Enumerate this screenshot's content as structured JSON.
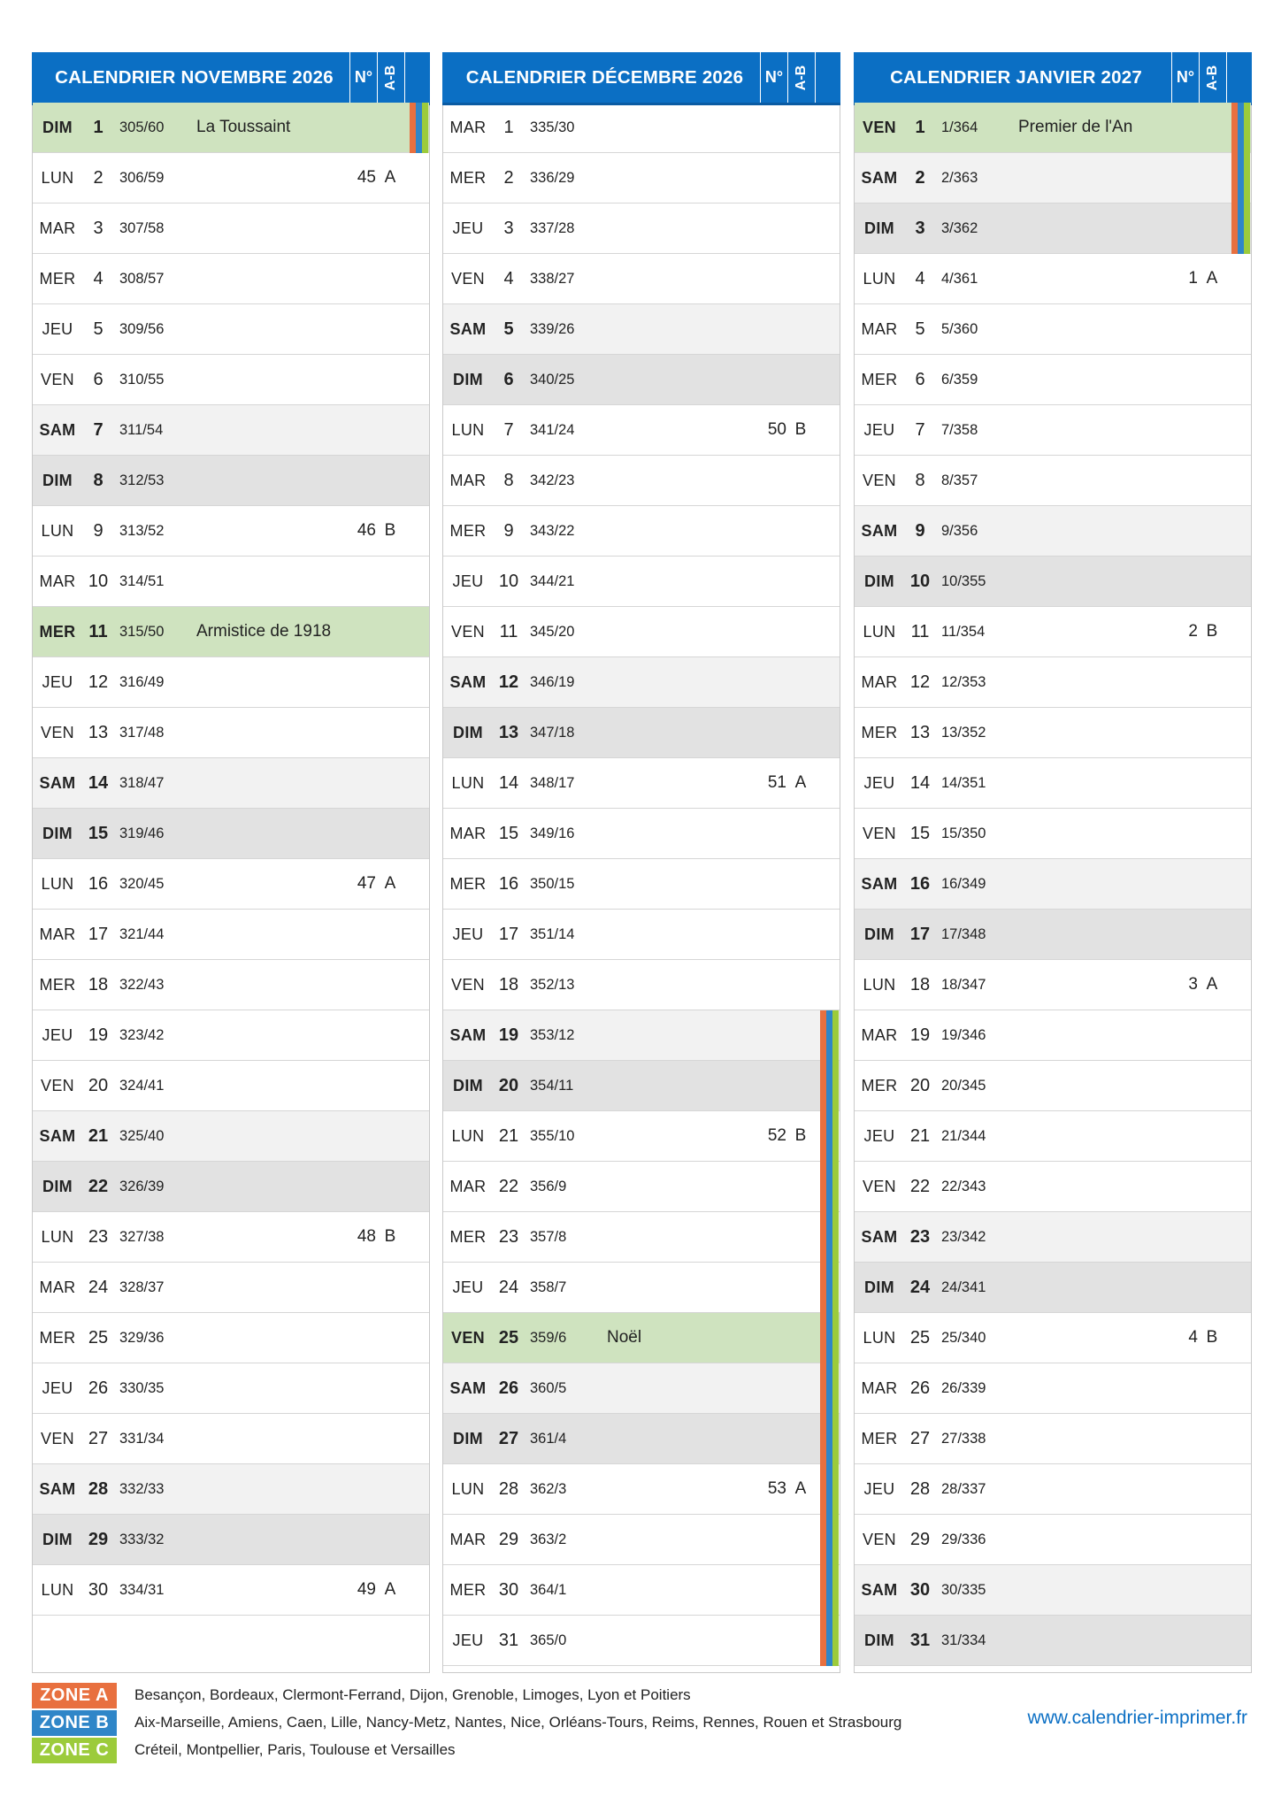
{
  "colors": {
    "header": "#0b6fc4",
    "zone_a": "#e8703f",
    "zone_b": "#2f86c8",
    "zone_c": "#9ccb3b",
    "holiday": "#cfe3bf"
  },
  "header_labels": {
    "num": "N°",
    "ab": "A-B"
  },
  "months": [
    {
      "title": "CALENDRIER NOVEMBRE 2026",
      "days": [
        {
          "dow": "DIM",
          "d": "1",
          "doy": "305/60",
          "type": "hol",
          "hol": "La Toussaint",
          "zones": [
            "a",
            "b",
            "c"
          ]
        },
        {
          "dow": "LUN",
          "d": "2",
          "doy": "306/59",
          "wk": "45",
          "ab": "A"
        },
        {
          "dow": "MAR",
          "d": "3",
          "doy": "307/58"
        },
        {
          "dow": "MER",
          "d": "4",
          "doy": "308/57"
        },
        {
          "dow": "JEU",
          "d": "5",
          "doy": "309/56"
        },
        {
          "dow": "VEN",
          "d": "6",
          "doy": "310/55"
        },
        {
          "dow": "SAM",
          "d": "7",
          "doy": "311/54",
          "type": "sat"
        },
        {
          "dow": "DIM",
          "d": "8",
          "doy": "312/53",
          "type": "sun"
        },
        {
          "dow": "LUN",
          "d": "9",
          "doy": "313/52",
          "wk": "46",
          "ab": "B"
        },
        {
          "dow": "MAR",
          "d": "10",
          "doy": "314/51"
        },
        {
          "dow": "MER",
          "d": "11",
          "doy": "315/50",
          "type": "hol",
          "hol": "Armistice de 1918"
        },
        {
          "dow": "JEU",
          "d": "12",
          "doy": "316/49"
        },
        {
          "dow": "VEN",
          "d": "13",
          "doy": "317/48"
        },
        {
          "dow": "SAM",
          "d": "14",
          "doy": "318/47",
          "type": "sat"
        },
        {
          "dow": "DIM",
          "d": "15",
          "doy": "319/46",
          "type": "sun"
        },
        {
          "dow": "LUN",
          "d": "16",
          "doy": "320/45",
          "wk": "47",
          "ab": "A"
        },
        {
          "dow": "MAR",
          "d": "17",
          "doy": "321/44"
        },
        {
          "dow": "MER",
          "d": "18",
          "doy": "322/43"
        },
        {
          "dow": "JEU",
          "d": "19",
          "doy": "323/42"
        },
        {
          "dow": "VEN",
          "d": "20",
          "doy": "324/41"
        },
        {
          "dow": "SAM",
          "d": "21",
          "doy": "325/40",
          "type": "sat"
        },
        {
          "dow": "DIM",
          "d": "22",
          "doy": "326/39",
          "type": "sun"
        },
        {
          "dow": "LUN",
          "d": "23",
          "doy": "327/38",
          "wk": "48",
          "ab": "B"
        },
        {
          "dow": "MAR",
          "d": "24",
          "doy": "328/37"
        },
        {
          "dow": "MER",
          "d": "25",
          "doy": "329/36"
        },
        {
          "dow": "JEU",
          "d": "26",
          "doy": "330/35"
        },
        {
          "dow": "VEN",
          "d": "27",
          "doy": "331/34"
        },
        {
          "dow": "SAM",
          "d": "28",
          "doy": "332/33",
          "type": "sat"
        },
        {
          "dow": "DIM",
          "d": "29",
          "doy": "333/32",
          "type": "sun"
        },
        {
          "dow": "LUN",
          "d": "30",
          "doy": "334/31",
          "wk": "49",
          "ab": "A"
        }
      ]
    },
    {
      "title": "CALENDRIER DÉCEMBRE 2026",
      "days": [
        {
          "dow": "MAR",
          "d": "1",
          "doy": "335/30"
        },
        {
          "dow": "MER",
          "d": "2",
          "doy": "336/29"
        },
        {
          "dow": "JEU",
          "d": "3",
          "doy": "337/28"
        },
        {
          "dow": "VEN",
          "d": "4",
          "doy": "338/27"
        },
        {
          "dow": "SAM",
          "d": "5",
          "doy": "339/26",
          "type": "sat"
        },
        {
          "dow": "DIM",
          "d": "6",
          "doy": "340/25",
          "type": "sun"
        },
        {
          "dow": "LUN",
          "d": "7",
          "doy": "341/24",
          "wk": "50",
          "ab": "B"
        },
        {
          "dow": "MAR",
          "d": "8",
          "doy": "342/23"
        },
        {
          "dow": "MER",
          "d": "9",
          "doy": "343/22"
        },
        {
          "dow": "JEU",
          "d": "10",
          "doy": "344/21"
        },
        {
          "dow": "VEN",
          "d": "11",
          "doy": "345/20"
        },
        {
          "dow": "SAM",
          "d": "12",
          "doy": "346/19",
          "type": "sat"
        },
        {
          "dow": "DIM",
          "d": "13",
          "doy": "347/18",
          "type": "sun"
        },
        {
          "dow": "LUN",
          "d": "14",
          "doy": "348/17",
          "wk": "51",
          "ab": "A"
        },
        {
          "dow": "MAR",
          "d": "15",
          "doy": "349/16"
        },
        {
          "dow": "MER",
          "d": "16",
          "doy": "350/15"
        },
        {
          "dow": "JEU",
          "d": "17",
          "doy": "351/14"
        },
        {
          "dow": "VEN",
          "d": "18",
          "doy": "352/13"
        },
        {
          "dow": "SAM",
          "d": "19",
          "doy": "353/12",
          "type": "sat",
          "zones": [
            "a",
            "b",
            "c"
          ]
        },
        {
          "dow": "DIM",
          "d": "20",
          "doy": "354/11",
          "type": "sun",
          "zones": [
            "a",
            "b",
            "c"
          ]
        },
        {
          "dow": "LUN",
          "d": "21",
          "doy": "355/10",
          "wk": "52",
          "ab": "B",
          "zones": [
            "a",
            "b",
            "c"
          ]
        },
        {
          "dow": "MAR",
          "d": "22",
          "doy": "356/9",
          "zones": [
            "a",
            "b",
            "c"
          ]
        },
        {
          "dow": "MER",
          "d": "23",
          "doy": "357/8",
          "zones": [
            "a",
            "b",
            "c"
          ]
        },
        {
          "dow": "JEU",
          "d": "24",
          "doy": "358/7",
          "zones": [
            "a",
            "b",
            "c"
          ]
        },
        {
          "dow": "VEN",
          "d": "25",
          "doy": "359/6",
          "type": "hol",
          "hol": "Noël",
          "zones": [
            "a",
            "b",
            "c"
          ]
        },
        {
          "dow": "SAM",
          "d": "26",
          "doy": "360/5",
          "type": "sat",
          "zones": [
            "a",
            "b",
            "c"
          ]
        },
        {
          "dow": "DIM",
          "d": "27",
          "doy": "361/4",
          "type": "sun",
          "zones": [
            "a",
            "b",
            "c"
          ]
        },
        {
          "dow": "LUN",
          "d": "28",
          "doy": "362/3",
          "wk": "53",
          "ab": "A",
          "zones": [
            "a",
            "b",
            "c"
          ]
        },
        {
          "dow": "MAR",
          "d": "29",
          "doy": "363/2",
          "zones": [
            "a",
            "b",
            "c"
          ]
        },
        {
          "dow": "MER",
          "d": "30",
          "doy": "364/1",
          "zones": [
            "a",
            "b",
            "c"
          ]
        },
        {
          "dow": "JEU",
          "d": "31",
          "doy": "365/0",
          "zones": [
            "a",
            "b",
            "c"
          ]
        }
      ]
    },
    {
      "title": "CALENDRIER JANVIER 2027",
      "days": [
        {
          "dow": "VEN",
          "d": "1",
          "doy": "1/364",
          "type": "hol",
          "hol": "Premier de l'An",
          "zones": [
            "a",
            "b",
            "c"
          ]
        },
        {
          "dow": "SAM",
          "d": "2",
          "doy": "2/363",
          "type": "sat",
          "zones": [
            "a",
            "b",
            "c"
          ]
        },
        {
          "dow": "DIM",
          "d": "3",
          "doy": "3/362",
          "type": "sun",
          "zones": [
            "a",
            "b",
            "c"
          ]
        },
        {
          "dow": "LUN",
          "d": "4",
          "doy": "4/361",
          "wk": "1",
          "ab": "A"
        },
        {
          "dow": "MAR",
          "d": "5",
          "doy": "5/360"
        },
        {
          "dow": "MER",
          "d": "6",
          "doy": "6/359"
        },
        {
          "dow": "JEU",
          "d": "7",
          "doy": "7/358"
        },
        {
          "dow": "VEN",
          "d": "8",
          "doy": "8/357"
        },
        {
          "dow": "SAM",
          "d": "9",
          "doy": "9/356",
          "type": "sat"
        },
        {
          "dow": "DIM",
          "d": "10",
          "doy": "10/355",
          "type": "sun"
        },
        {
          "dow": "LUN",
          "d": "11",
          "doy": "11/354",
          "wk": "2",
          "ab": "B"
        },
        {
          "dow": "MAR",
          "d": "12",
          "doy": "12/353"
        },
        {
          "dow": "MER",
          "d": "13",
          "doy": "13/352"
        },
        {
          "dow": "JEU",
          "d": "14",
          "doy": "14/351"
        },
        {
          "dow": "VEN",
          "d": "15",
          "doy": "15/350"
        },
        {
          "dow": "SAM",
          "d": "16",
          "doy": "16/349",
          "type": "sat"
        },
        {
          "dow": "DIM",
          "d": "17",
          "doy": "17/348",
          "type": "sun"
        },
        {
          "dow": "LUN",
          "d": "18",
          "doy": "18/347",
          "wk": "3",
          "ab": "A"
        },
        {
          "dow": "MAR",
          "d": "19",
          "doy": "19/346"
        },
        {
          "dow": "MER",
          "d": "20",
          "doy": "20/345"
        },
        {
          "dow": "JEU",
          "d": "21",
          "doy": "21/344"
        },
        {
          "dow": "VEN",
          "d": "22",
          "doy": "22/343"
        },
        {
          "dow": "SAM",
          "d": "23",
          "doy": "23/342",
          "type": "sat"
        },
        {
          "dow": "DIM",
          "d": "24",
          "doy": "24/341",
          "type": "sun"
        },
        {
          "dow": "LUN",
          "d": "25",
          "doy": "25/340",
          "wk": "4",
          "ab": "B"
        },
        {
          "dow": "MAR",
          "d": "26",
          "doy": "26/339"
        },
        {
          "dow": "MER",
          "d": "27",
          "doy": "27/338"
        },
        {
          "dow": "JEU",
          "d": "28",
          "doy": "28/337"
        },
        {
          "dow": "VEN",
          "d": "29",
          "doy": "29/336"
        },
        {
          "dow": "SAM",
          "d": "30",
          "doy": "30/335",
          "type": "sat"
        },
        {
          "dow": "DIM",
          "d": "31",
          "doy": "31/334",
          "type": "sun"
        }
      ]
    }
  ],
  "legend": [
    {
      "label": "ZONE A",
      "zone": "a",
      "text": "Besançon, Bordeaux, Clermont-Ferrand, Dijon, Grenoble, Limoges, Lyon et Poitiers"
    },
    {
      "label": "ZONE B",
      "zone": "b",
      "text": "Aix-Marseille, Amiens, Caen, Lille, Nancy-Metz, Nantes, Nice, Orléans-Tours, Reims, Rennes, Rouen et Strasbourg"
    },
    {
      "label": "ZONE C",
      "zone": "c",
      "text": "Créteil, Montpellier, Paris, Toulouse et Versailles"
    }
  ],
  "website": "www.calendrier-imprimer.fr"
}
